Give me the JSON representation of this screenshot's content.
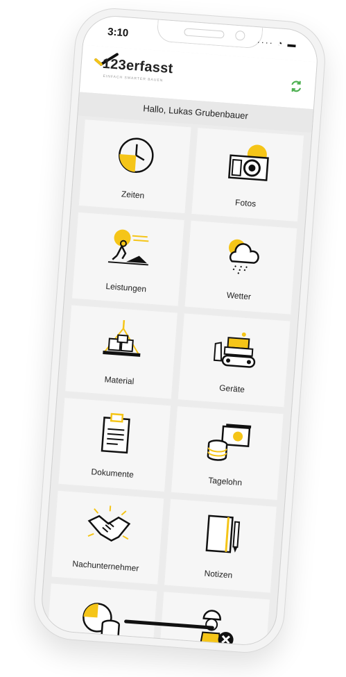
{
  "status_bar": {
    "time": "3:10"
  },
  "header": {
    "app_name": "123erfasst",
    "tagline": "EINFACH SMARTER BAUEN",
    "sync_icon": "sync-icon",
    "accent_color": "#f5c518",
    "sync_color": "#4caf50"
  },
  "greeting": "Hallo, Lukas Grubenbauer",
  "tiles": [
    {
      "label": "Zeiten",
      "icon": "clock-icon"
    },
    {
      "label": "Fotos",
      "icon": "camera-icon"
    },
    {
      "label": "Leistungen",
      "icon": "worker-shovel-icon"
    },
    {
      "label": "Wetter",
      "icon": "weather-icon"
    },
    {
      "label": "Material",
      "icon": "pallet-crane-icon"
    },
    {
      "label": "Geräte",
      "icon": "bulldozer-icon"
    },
    {
      "label": "Dokumente",
      "icon": "clipboard-icon"
    },
    {
      "label": "Tagelohn",
      "icon": "money-coins-icon"
    },
    {
      "label": "Nachunternehmer",
      "icon": "handshake-icon"
    },
    {
      "label": "Notizen",
      "icon": "notebook-pen-icon"
    },
    {
      "label": "",
      "icon": "chart-coins-icon"
    },
    {
      "label": "",
      "icon": "worker-remove-icon"
    }
  ]
}
